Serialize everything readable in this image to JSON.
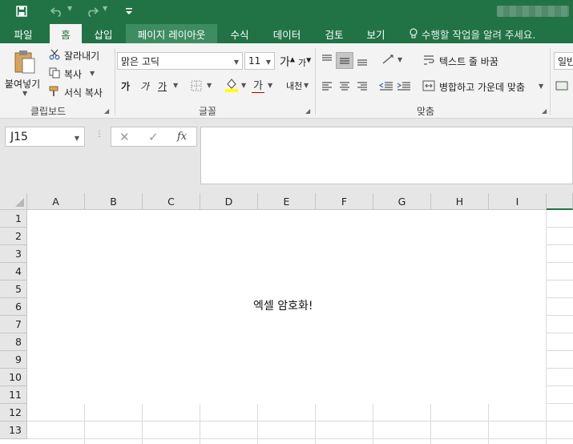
{
  "titlebar": {
    "save_icon": "save-icon",
    "undo_icon": "undo-icon",
    "redo_icon": "redo-icon",
    "customize_icon": "customize-quick-access-icon"
  },
  "tabs": [
    {
      "label": "파일"
    },
    {
      "label": "홈"
    },
    {
      "label": "삽입"
    },
    {
      "label": "페이지 레이아웃"
    },
    {
      "label": "수식"
    },
    {
      "label": "데이터"
    },
    {
      "label": "검토"
    },
    {
      "label": "보기"
    }
  ],
  "tell_me": {
    "text": "수행할 작업을 알려 주세요."
  },
  "ribbon": {
    "clipboard": {
      "paste": "붙여넣기",
      "cut": "잘라내기",
      "copy": "복사",
      "format_painter": "서식 복사",
      "group": "클립보드"
    },
    "font": {
      "font_name": "맑은 고딕",
      "font_size": "11",
      "bold": "가",
      "italic": "가",
      "underline": "가",
      "font_color_glyph": "가",
      "phonetic": "내천",
      "grow_glyph": "가",
      "shrink_glyph": "가",
      "group": "글꼴"
    },
    "alignment": {
      "wrap_text": "텍스트 줄 바꿈",
      "merge_center": "병합하고 가운데 맞춤",
      "group": "맞춤"
    },
    "number": {
      "format": "일반"
    }
  },
  "formula_bar": {
    "name_box": "J15",
    "cancel": "✕",
    "enter": "✓",
    "fx": "fx",
    "value": ""
  },
  "sheet": {
    "columns": [
      "A",
      "B",
      "C",
      "D",
      "E",
      "F",
      "G",
      "H",
      "I"
    ],
    "rows": [
      "1",
      "2",
      "3",
      "4",
      "5",
      "6",
      "7",
      "8",
      "9",
      "10",
      "11",
      "12",
      "13"
    ],
    "textbox_text": "엑셀 암호화!"
  },
  "colors": {
    "accent": "#217346",
    "font_color": "#c00000",
    "fill_color": "#ffff00"
  }
}
